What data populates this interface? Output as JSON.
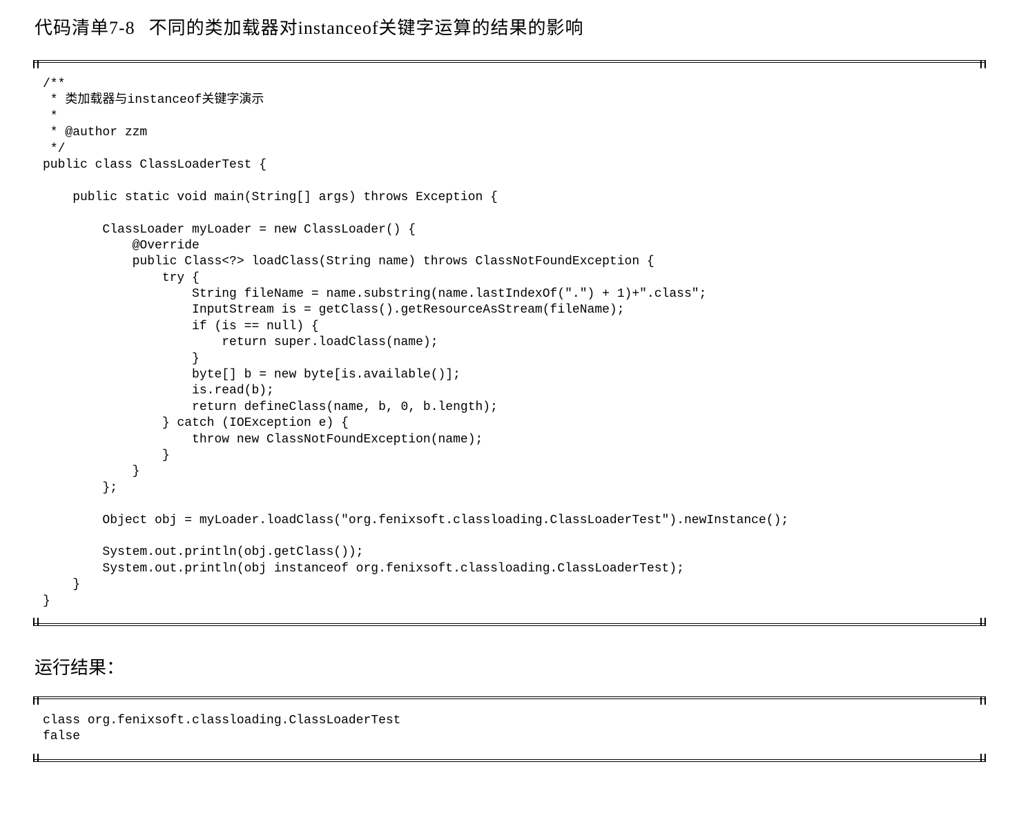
{
  "listing": {
    "label": "代码清单7-8",
    "caption": "不同的类加载器对instanceof关键字运算的结果的影响"
  },
  "code_block_1": "/**\n * 类加载器与instanceof关键字演示\n * \n * @author zzm\n */\npublic class ClassLoaderTest {\n\n    public static void main(String[] args) throws Exception {\n\n        ClassLoader myLoader = new ClassLoader() {\n            @Override\n            public Class<?> loadClass(String name) throws ClassNotFoundException {\n                try {\n                    String fileName = name.substring(name.lastIndexOf(\".\") + 1)+\".class\";\n                    InputStream is = getClass().getResourceAsStream(fileName);\n                    if (is == null) {\n                        return super.loadClass(name);\n                    }\n                    byte[] b = new byte[is.available()];\n                    is.read(b);\n                    return defineClass(name, b, 0, b.length);\n                } catch (IOException e) {\n                    throw new ClassNotFoundException(name);\n                }\n            }\n        };\n\n        Object obj = myLoader.loadClass(\"org.fenixsoft.classloading.ClassLoaderTest\").newInstance();\n\n        System.out.println(obj.getClass());\n        System.out.println(obj instanceof org.fenixsoft.classloading.ClassLoaderTest);\n    }\n}",
  "result_heading": "运行结果：",
  "code_block_2": "class org.fenixsoft.classloading.ClassLoaderTest\nfalse"
}
